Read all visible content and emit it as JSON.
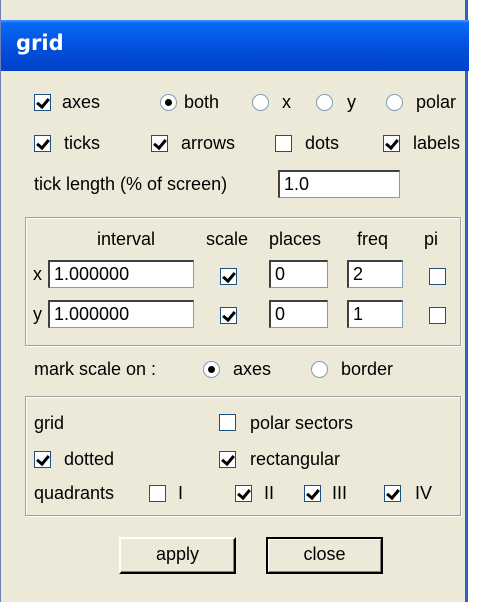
{
  "window": {
    "title": "grid"
  },
  "row1": {
    "axes": {
      "label": "axes",
      "checked": true
    },
    "mode_options": [
      {
        "label": "both",
        "selected": true
      },
      {
        "label": "x",
        "selected": false
      },
      {
        "label": "y",
        "selected": false
      },
      {
        "label": "polar",
        "selected": false
      }
    ]
  },
  "row2": [
    {
      "label": "ticks",
      "checked": true
    },
    {
      "label": "arrows",
      "checked": true
    },
    {
      "label": "dots",
      "checked": false
    },
    {
      "label": "labels",
      "checked": true
    }
  ],
  "tick_length": {
    "label": "tick length (% of screen)",
    "value": "1.0"
  },
  "table": {
    "headers": [
      "interval",
      "scale",
      "places",
      "freq",
      "pi"
    ],
    "rows": [
      {
        "axis": "x",
        "interval": "1.000000",
        "scale": true,
        "places": "0",
        "freq": "2",
        "pi": false
      },
      {
        "axis": "y",
        "interval": "1.000000",
        "scale": true,
        "places": "0",
        "freq": "1",
        "pi": false
      }
    ]
  },
  "mark_scale": {
    "label": "mark scale on :",
    "options": [
      {
        "label": "axes",
        "selected": true
      },
      {
        "label": "border",
        "selected": false
      }
    ]
  },
  "grid_group": {
    "label": "grid",
    "polar_sectors": {
      "label": "polar sectors",
      "checked": false
    },
    "dotted": {
      "label": "dotted",
      "checked": true
    },
    "rectangular": {
      "label": "rectangular",
      "checked": true
    },
    "quadrants_label": "quadrants",
    "quadrants": [
      {
        "label": "I",
        "checked": false
      },
      {
        "label": "II",
        "checked": true
      },
      {
        "label": "III",
        "checked": true
      },
      {
        "label": "IV",
        "checked": true
      }
    ]
  },
  "buttons": {
    "apply": "apply",
    "close": "close"
  }
}
